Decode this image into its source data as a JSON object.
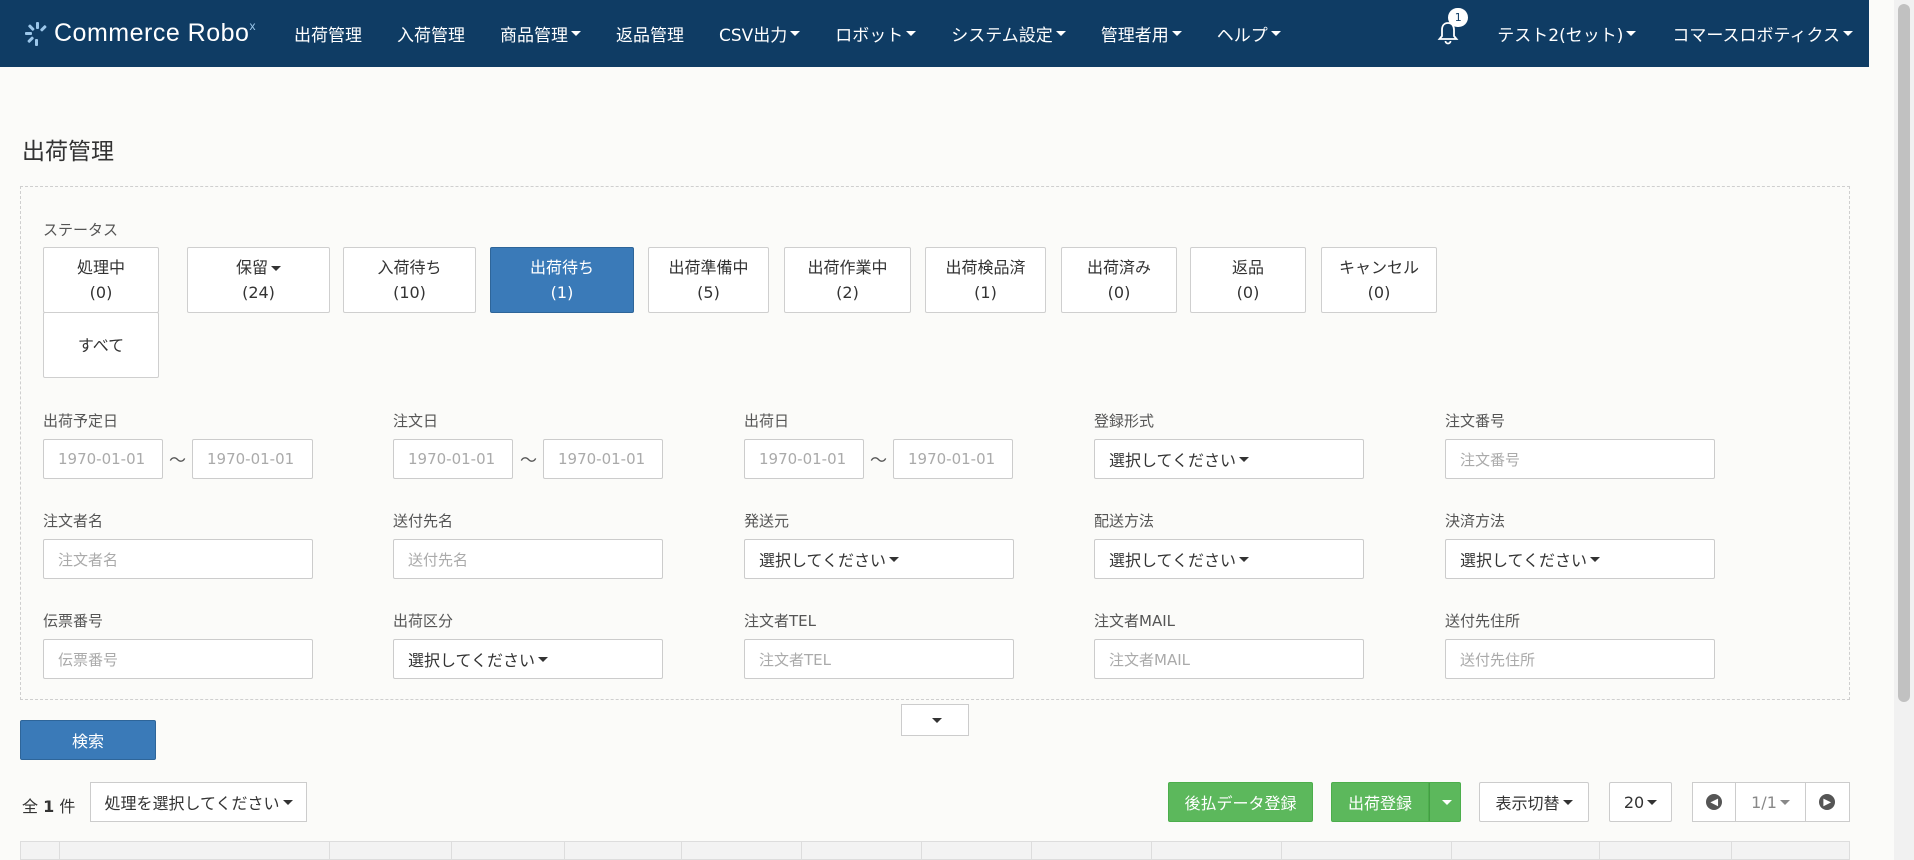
{
  "navbar": {
    "logo_text": "Commerce Robo",
    "logo_sup": "x",
    "items": [
      "出荷管理",
      "入荷管理",
      "商品管理",
      "返品管理",
      "CSV出力",
      "ロボット",
      "システム設定",
      "管理者用",
      "ヘルプ"
    ],
    "has_caret": [
      false,
      false,
      true,
      false,
      true,
      true,
      true,
      true,
      true
    ],
    "notification_count": "1",
    "user": "テスト2(セット)",
    "company": "コマースロボティクス"
  },
  "page": {
    "title": "出荷管理"
  },
  "status": {
    "label": "ステータス",
    "buttons": [
      {
        "label": "処理中",
        "count": "(0)"
      },
      {
        "label": "保留",
        "count": "(24)"
      },
      {
        "label": "入荷待ち",
        "count": "(10)"
      },
      {
        "label": "出荷待ち",
        "count": "(1)"
      },
      {
        "label": "出荷準備中",
        "count": "(5)"
      },
      {
        "label": "出荷作業中",
        "count": "(2)"
      },
      {
        "label": "出荷検品済",
        "count": "(1)"
      },
      {
        "label": "出荷済み",
        "count": "(0)"
      },
      {
        "label": "返品",
        "count": "(0)"
      },
      {
        "label": "キャンセル",
        "count": "(0)"
      },
      {
        "label": "すべて",
        "count": ""
      }
    ],
    "active": "出荷待ち"
  },
  "filters": {
    "ship_plan_date": {
      "label": "出荷予定日",
      "from": "1970-01-01",
      "to": "1970-01-01"
    },
    "order_date": {
      "label": "注文日",
      "from": "1970-01-01",
      "to": "1970-01-01"
    },
    "ship_date": {
      "label": "出荷日",
      "from": "1970-01-01",
      "to": "1970-01-01"
    },
    "tilde": "〜",
    "register_type": {
      "label": "登録形式",
      "value": "選択してください"
    },
    "order_number": {
      "label": "注文番号",
      "placeholder": "注文番号"
    },
    "orderer_name": {
      "label": "注文者名",
      "placeholder": "注文者名"
    },
    "recipient_name": {
      "label": "送付先名",
      "placeholder": "送付先名"
    },
    "sender": {
      "label": "発送元",
      "value": "選択してください"
    },
    "delivery_method": {
      "label": "配送方法",
      "value": "選択してください"
    },
    "payment_method": {
      "label": "決済方法",
      "value": "選択してください"
    },
    "slip_number": {
      "label": "伝票番号",
      "placeholder": "伝票番号"
    },
    "ship_category": {
      "label": "出荷区分",
      "value": "選択してください"
    },
    "orderer_tel": {
      "label": "注文者TEL",
      "placeholder": "注文者TEL"
    },
    "orderer_mail": {
      "label": "注文者MAIL",
      "placeholder": "注文者MAIL"
    },
    "recipient_address": {
      "label": "送付先住所",
      "placeholder": "送付先住所"
    }
  },
  "search_button": "検索",
  "results": {
    "total_prefix": "全",
    "total_count": "1",
    "total_suffix": "件",
    "action_select": "処理を選択してください",
    "deferred_payment_button": "後払データ登録",
    "ship_register_button": "出荷登録",
    "display_toggle": "表示切替",
    "page_size": "20",
    "page_indicator": "1/1"
  },
  "colors": {
    "navbar": "#0f3c64",
    "primary": "#3a7ab8",
    "success": "#5cb85c"
  }
}
